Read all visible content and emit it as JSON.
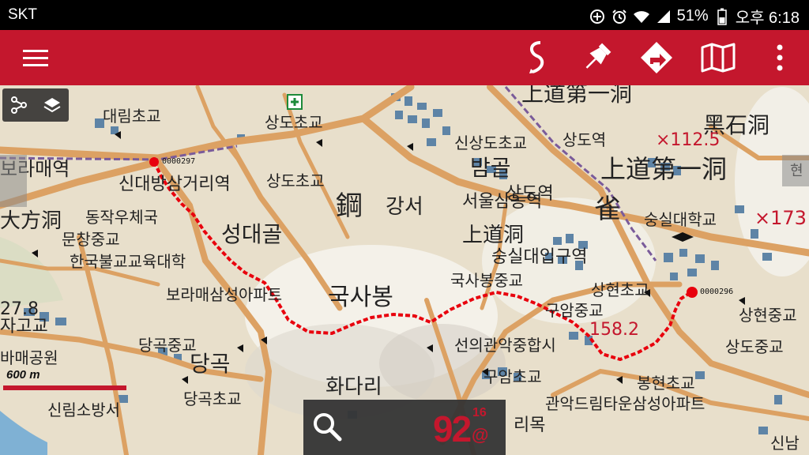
{
  "status_bar": {
    "carrier": "SKT",
    "battery": "51%",
    "time": "오후 6:18",
    "icons": [
      "data-saver-icon",
      "alarm-icon",
      "wifi-icon",
      "signal-icon",
      "battery-icon"
    ]
  },
  "toolbar": {
    "background": "#c4172d",
    "buttons": [
      "menu-icon",
      "route-icon",
      "pin-icon",
      "directions-icon",
      "map-icon",
      "more-vert-icon"
    ]
  },
  "map": {
    "waypoints": {
      "start": "0000297",
      "end": "0000296"
    },
    "labels": {
      "l1": "대림초교",
      "l2": "상도초교",
      "l3": "上道第一洞",
      "l4": "黑石洞",
      "l5": "×112.5",
      "l6": "신상도초교",
      "l7": "상도역",
      "l8": "上道第一洞",
      "l9": "상도초교",
      "l10": "신대방삼거리역",
      "l11": "보라매역",
      "l12": "밤골",
      "l13": "서울삼동역",
      "l14": "상도역",
      "l15": "숭실대학교",
      "l16": "×173",
      "l17": "大方洞",
      "l18": "동작우체국",
      "l19": "문창중교",
      "l20": "성대골",
      "l21": "上道洞",
      "l22": "숭실대입구역",
      "l23": "한국불교교육대학",
      "l24": "국사봉중교",
      "l25": "상현초교",
      "l26": "보라매삼성아파트",
      "l27": "국사봉",
      "l28": "상현중교",
      "l29": "27.8",
      "l30": "자고교",
      "l31": "구암중교",
      "l32": "158.2",
      "l33": "상도중교",
      "l34": "당곡중교",
      "l35": "당곡",
      "l36": "선의관악중합시",
      "l37": "봉현초교",
      "l38": "화다리",
      "l39": "구암초교",
      "l40": "당곡초교",
      "l41": "관악드림타운삼성아파트",
      "l42": "신림소방서",
      "l43": "신남",
      "l44": "강서",
      "l45": "바매공원",
      "l46": "鋼",
      "l47": "雀",
      "l48": "현",
      "l49": "리목"
    }
  },
  "layer_panel": {
    "icons": [
      "waypoints-icon",
      "layers-icon"
    ]
  },
  "scale": {
    "label": "600 m"
  },
  "speed_panel": {
    "value": "92",
    "sup": "16",
    "unit": "@"
  },
  "colors": {
    "track": "#e8000d",
    "accent": "#c4172d",
    "road": "#dca163",
    "building": "#5e84a6"
  }
}
